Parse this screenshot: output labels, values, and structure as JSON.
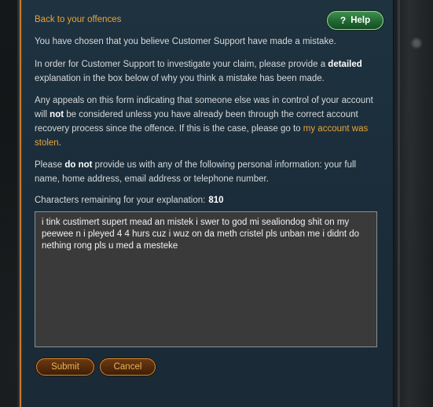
{
  "nav": {
    "back_label": "Back to your offences"
  },
  "help": {
    "label": "Help",
    "icon": "?"
  },
  "paragraphs": {
    "p1": "You have chosen that you believe Customer Support have made a mistake.",
    "p2_a": "In order for Customer Support to investigate your claim, please provide a ",
    "p2_bold": "detailed",
    "p2_b": " explanation in the box below of why you think a mistake has been made.",
    "p3_a": "Any appeals on this form indicating that someone else was in control of your account will ",
    "p3_bold": "not",
    "p3_b": " be considered unless you have already been through the correct account recovery process since the offence. If this is the case, please go to ",
    "p3_link": "my account was stolen",
    "p3_c": ".",
    "p4_a": "Please ",
    "p4_bold": "do not",
    "p4_b": " provide us with any of the following personal information: your full name, home address, email address or telephone number."
  },
  "explanation": {
    "label": "Characters remaining for your explanation:",
    "remaining": "810",
    "text": "i tink custimert supert mead an mistek i swer to god mi sealiondog shit on my peewee n i pleyed 4 4 hurs cuz i wuz on da meth cristel pls unban me i didnt do nething rong pls u med a mesteke"
  },
  "buttons": {
    "submit": "Submit",
    "cancel": "Cancel"
  },
  "colors": {
    "accent": "#e8a43a",
    "panel": "#1e3240",
    "help_green": "#1f6530"
  }
}
